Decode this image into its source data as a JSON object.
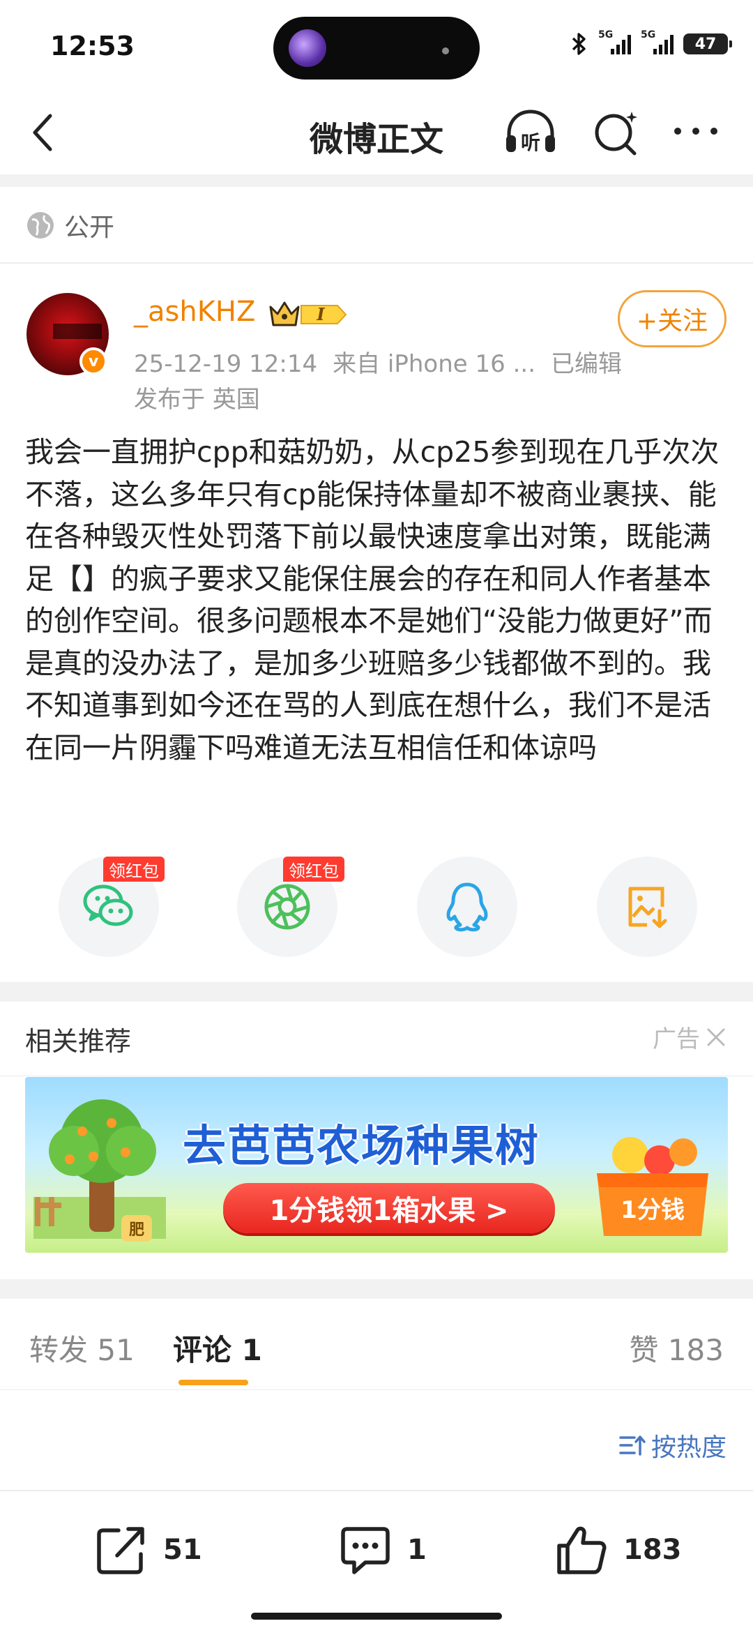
{
  "status_bar": {
    "time": "12:53",
    "signal1_label": "5G",
    "signal2_label": "5G",
    "battery": "47"
  },
  "nav": {
    "title": "微博正文",
    "listen_label": "听"
  },
  "post": {
    "visibility": "公开",
    "author": "_ashKHZ",
    "level_badge": "I",
    "verified_mark": "v",
    "datetime": "25-12-19 12:14",
    "source": "来自 iPhone 16 ...",
    "edited": "已编辑",
    "location": "发布于 英国",
    "follow_label": "+关注",
    "body": "我会一直拥护cpp和菇奶奶，从cp25参到现在几乎次次不落，这么多年只有cp能保持体量却不被商业裹挟、能在各种毁灭性处罚落下前以最快速度拿出对策，既能满足【】的疯子要求又能保住展会的存在和同人作者基本的创作空间。很多问题根本不是她们“没能力做更好”而是真的没办法了，是加多少班赔多少钱都做不到的。我不知道事到如今还在骂的人到底在想什么，我们不是活在同一片阴霾下吗难道无法互相信任和体谅吗"
  },
  "share": {
    "red_packet_label": "领红包",
    "items": [
      "wechat-icon",
      "moments-icon",
      "qq-icon",
      "save-image-icon"
    ]
  },
  "related": {
    "title": "相关推荐",
    "ad_label": "广告",
    "banner_title": "去芭芭农场种果树",
    "banner_cta": "1分钱领1箱水果 >",
    "banner_price": "1分钱",
    "banner_tree_tag": "肥"
  },
  "tabs": {
    "forward": "转发 51",
    "comment": "评论 1",
    "like": "赞 183",
    "sort": "按热度"
  },
  "bottom_bar": {
    "repost_count": "51",
    "comment_count": "1",
    "like_count": "183"
  },
  "colors": {
    "accent_orange": "#f08200",
    "link_blue": "#4876c0",
    "tab_underline": "#f6a21a"
  }
}
